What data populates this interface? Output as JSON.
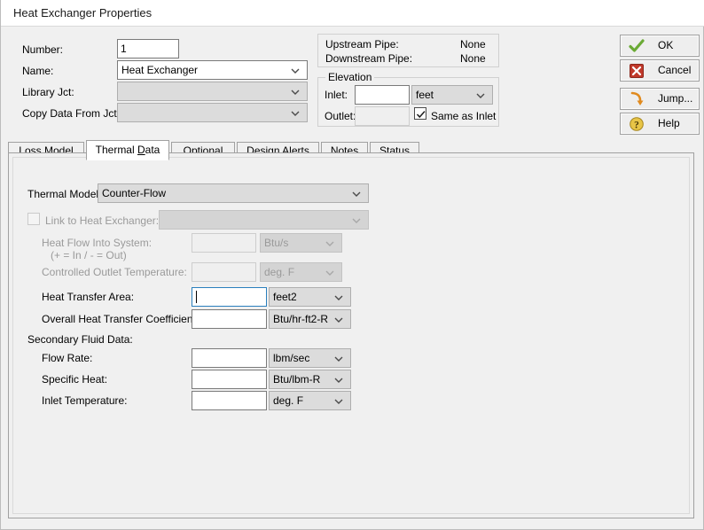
{
  "window": {
    "title": "Heat Exchanger Properties"
  },
  "header": {
    "fields": [
      {
        "label": "Number:",
        "value": "1"
      },
      {
        "label": "Name:",
        "value": "Heat Exchanger"
      },
      {
        "label": "Library Jct:",
        "value": ""
      },
      {
        "label": "Copy Data From Jct...",
        "value": ""
      }
    ],
    "number_label": "Number:",
    "number_value": "1",
    "name_label": "Name:",
    "name_value": "Heat Exchanger",
    "library_jct_label": "Library Jct:",
    "library_jct_value": "",
    "copy_data_label": "Copy Data From Jct...",
    "copy_data_value": ""
  },
  "connections": {
    "upstream_label": "Upstream Pipe:",
    "upstream_value": "None",
    "downstream_label": "Downstream Pipe:",
    "downstream_value": "None"
  },
  "elevation": {
    "group_title": "Elevation",
    "inlet_label": "Inlet:",
    "inlet_value": "",
    "inlet_units": "feet",
    "outlet_label": "Outlet:",
    "outlet_value": "",
    "same_as_inlet_label": "Same as Inlet",
    "same_as_inlet_checked": true
  },
  "buttons": [
    {
      "label": "OK",
      "icon": "green-check-icon"
    },
    {
      "label": "Cancel",
      "icon": "red-x-icon"
    },
    {
      "label": "Jump...",
      "icon": "orange-arrow-icon"
    },
    {
      "label": "Help",
      "icon": "yellow-question-icon"
    }
  ],
  "tabs": [
    {
      "label": "Loss Model",
      "accel_index": 0,
      "active": false
    },
    {
      "label": "Thermal Data",
      "accel_index": 8,
      "active": true
    },
    {
      "label": "Optional",
      "accel_index": 1,
      "active": false
    },
    {
      "label": "Design Alerts",
      "accel_index": 0,
      "active": false
    },
    {
      "label": "Notes",
      "accel_index": 2,
      "active": false
    },
    {
      "label": "Status",
      "accel_index": 0,
      "active": false
    }
  ],
  "thermal": {
    "thermal_model_label": "Thermal Model:",
    "thermal_model_value": "Counter-Flow",
    "link_label": "Link to Heat Exchanger:",
    "link_checked": false,
    "link_value": "",
    "heat_flow_label": "Heat Flow Into System:",
    "heat_flow_sublabel": "(+ = In / - = Out)",
    "heat_flow_value": "",
    "heat_flow_units": "Btu/s",
    "controlled_outlet_label": "Controlled Outlet Temperature:",
    "controlled_outlet_value": "",
    "controlled_outlet_units": "deg. F",
    "heat_transfer_area_label": "Heat Transfer Area:",
    "heat_transfer_area_value": "",
    "heat_transfer_area_units": "feet2",
    "overall_coeff_label": "Overall Heat Transfer Coefficient:",
    "overall_coeff_value": "",
    "overall_coeff_units": "Btu/hr-ft2-R",
    "secondary_fluid_label": "Secondary Fluid Data:",
    "flow_rate_label": "Flow Rate:",
    "flow_rate_value": "",
    "flow_rate_units": "lbm/sec",
    "specific_heat_label": "Specific Heat:",
    "specific_heat_value": "",
    "specific_heat_units": "Btu/lbm-R",
    "inlet_temp_label": "Inlet Temperature:",
    "inlet_temp_value": "",
    "inlet_temp_units": "deg. F"
  },
  "colors": {
    "dialog_bg": "#f0f0f0",
    "titlebar_bg": "#ffffff",
    "field_bg": "#ffffff",
    "disabled_bg": "#d4d4d4",
    "focus_border": "#2a7fbd",
    "ok_icon": "#6aaa35",
    "cancel_icon": "#c0392b",
    "jump_icon": "#e08a1e",
    "help_icon": "#e8c547"
  }
}
